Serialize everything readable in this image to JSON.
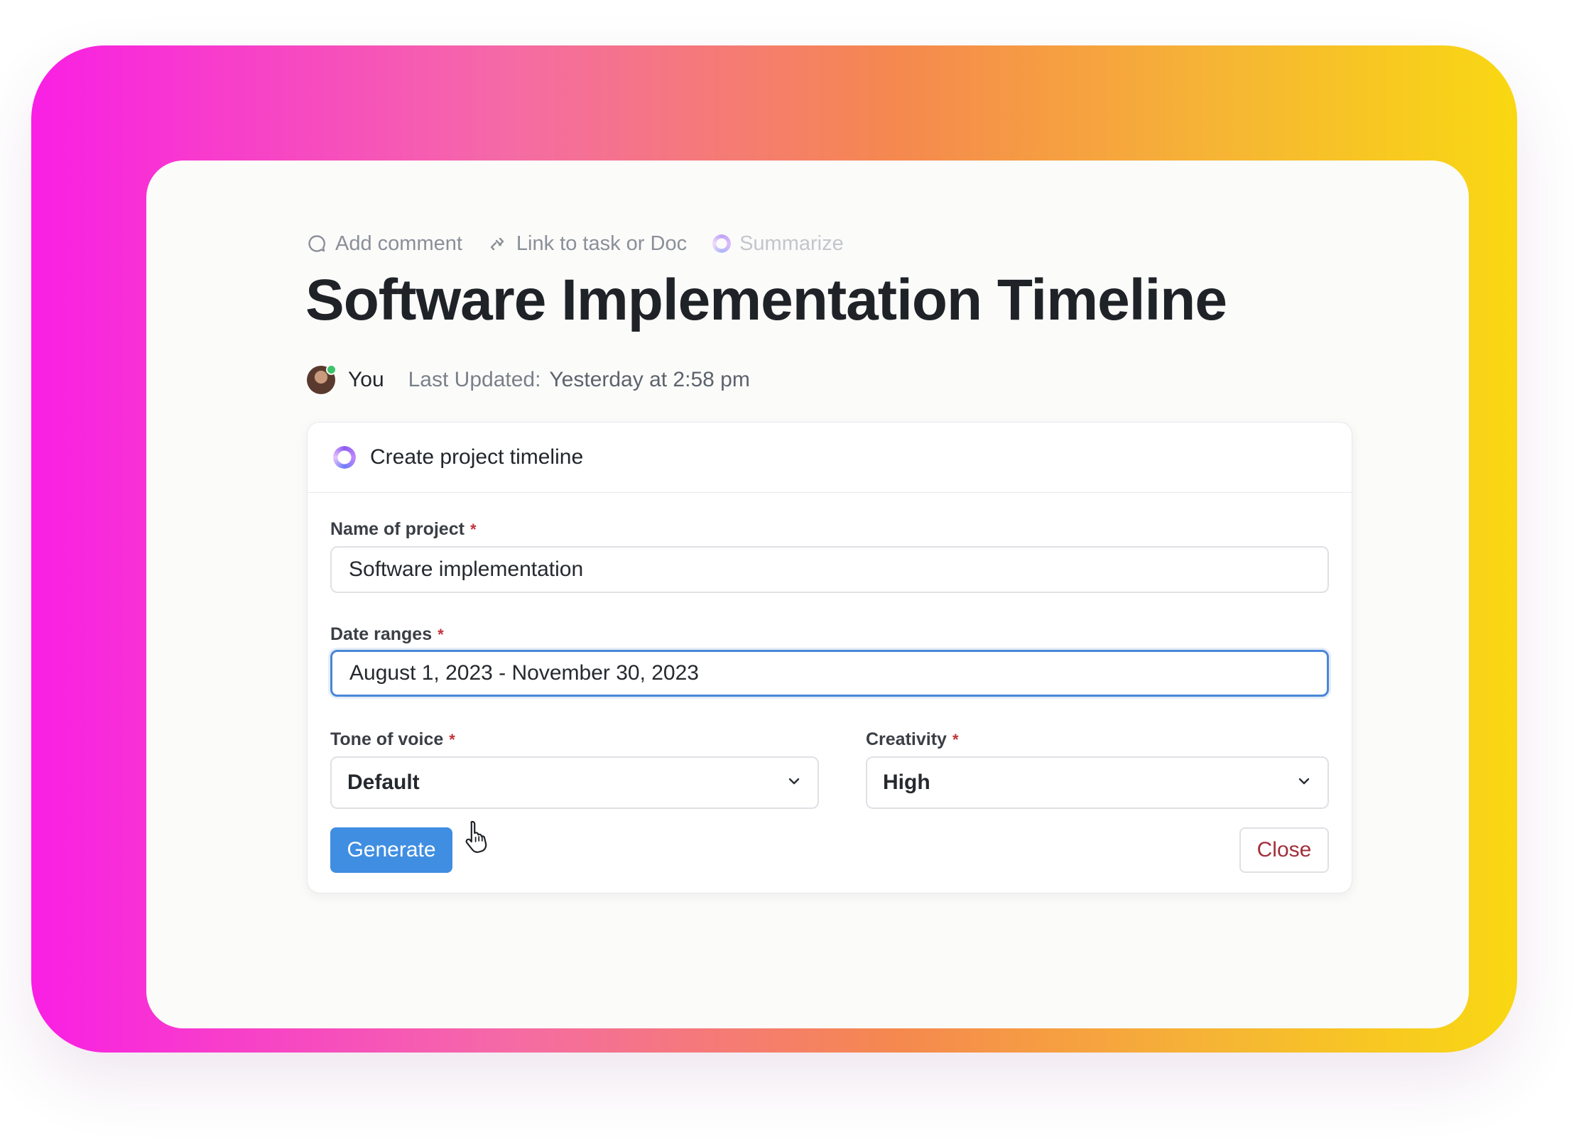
{
  "toolbar": {
    "add_comment": "Add comment",
    "link_task": "Link to task or Doc",
    "summarize": "Summarize"
  },
  "doc": {
    "title": "Software Implementation Timeline",
    "author": "You",
    "updated_label": "Last Updated:",
    "updated_value": "Yesterday at 2:58 pm"
  },
  "panel": {
    "header": "Create project timeline",
    "required_mark": "*",
    "fields": {
      "project_name": {
        "label": "Name of project",
        "value": "Software implementation"
      },
      "date_ranges": {
        "label": "Date ranges",
        "value": "August 1, 2023 - November 30, 2023"
      },
      "tone": {
        "label": "Tone of voice",
        "value": "Default"
      },
      "creativity": {
        "label": "Creativity",
        "value": "High"
      }
    },
    "generate_label": "Generate",
    "close_label": "Close"
  },
  "icons": {
    "comment": "comment-icon",
    "link": "link-icon",
    "summarize": "ai-ring-icon",
    "chevron": "chevron-down-icon",
    "cursor": "hand-pointer-icon"
  },
  "colors": {
    "accent": "#3f8ee2",
    "close_text": "#a1303a",
    "required": "#c2323b",
    "frame_left": "#f91fe4",
    "frame_right": "#f9d812"
  }
}
